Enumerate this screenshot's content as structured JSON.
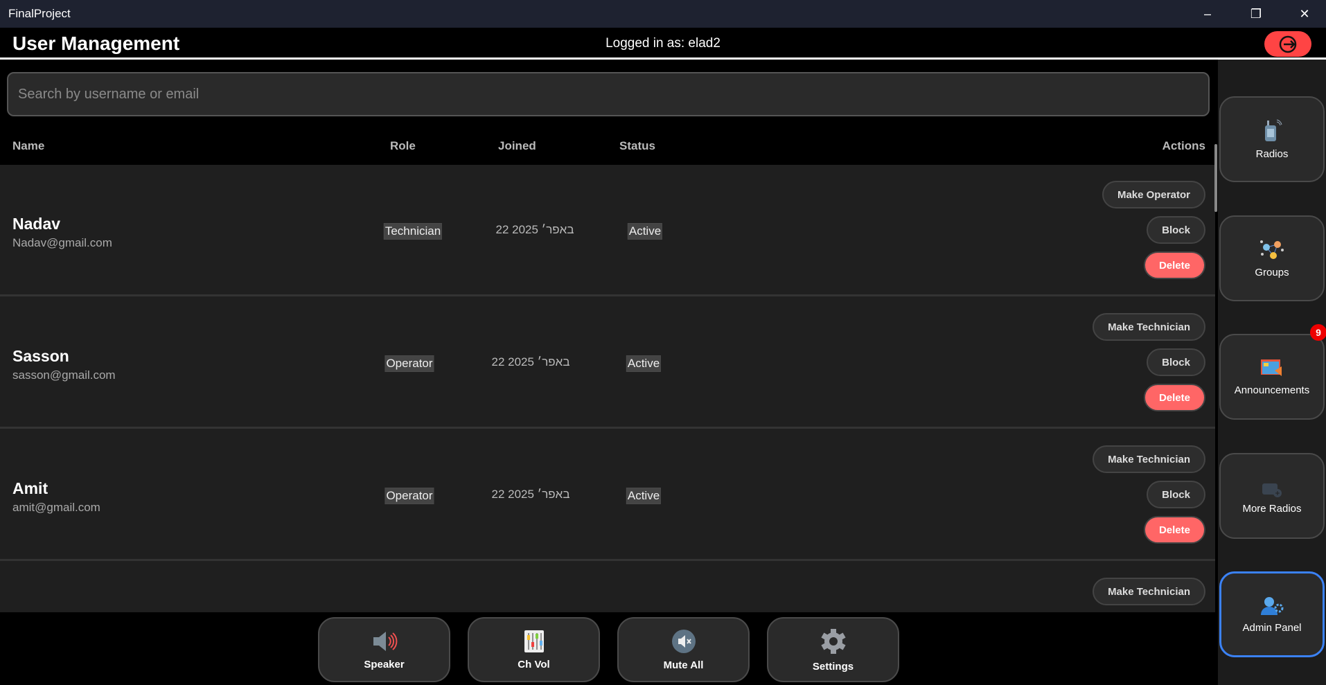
{
  "window": {
    "title": "FinalProject",
    "minimize": "–",
    "maximize": "❐",
    "close": "✕"
  },
  "header": {
    "title": "User Management",
    "logged_in": "Logged in as: elad2",
    "logout_icon": "logout-icon",
    "logout_color": "#ff4444"
  },
  "search": {
    "placeholder": "Search by username or email",
    "value": ""
  },
  "columns": {
    "name": "Name",
    "role": "Role",
    "joined": "Joined",
    "status": "Status",
    "actions": "Actions"
  },
  "users": [
    {
      "name": "Nadav",
      "email": "Nadav@gmail.com",
      "role": "Technician",
      "joined": "22 באפר׳ 2025",
      "status": "Active",
      "make": "Make Operator",
      "block": "Block",
      "delete": "Delete"
    },
    {
      "name": "Sasson",
      "email": "sasson@gmail.com",
      "role": "Operator",
      "joined": "22 באפר׳ 2025",
      "status": "Active",
      "make": "Make Technician",
      "block": "Block",
      "delete": "Delete"
    },
    {
      "name": "Amit",
      "email": "amit@gmail.com",
      "role": "Operator",
      "joined": "22 באפר׳ 2025",
      "status": "Active",
      "make": "Make Technician",
      "block": "Block",
      "delete": "Delete"
    },
    {
      "make": "Make Technician"
    }
  ],
  "sidebar": {
    "items": [
      {
        "label": "Radios",
        "icon": "walkie-talkie-icon"
      },
      {
        "label": "Groups",
        "icon": "network-icon"
      },
      {
        "label": "Announcements",
        "icon": "megaphone-icon",
        "badge": "9"
      },
      {
        "label": "More Radios",
        "icon": "radio-add-icon"
      },
      {
        "label": "Admin Panel",
        "icon": "admin-user-gear-icon",
        "active": true
      }
    ]
  },
  "bottom": {
    "items": [
      {
        "label": "Speaker",
        "icon": "speaker-icon"
      },
      {
        "label": "Ch Vol",
        "icon": "mixer-icon"
      },
      {
        "label": "Mute All",
        "icon": "mute-icon"
      },
      {
        "label": "Settings",
        "icon": "gear-icon"
      }
    ]
  },
  "colors": {
    "delete": "#ff6666",
    "active_border": "#3b82f6",
    "badge": "#ee0000"
  }
}
